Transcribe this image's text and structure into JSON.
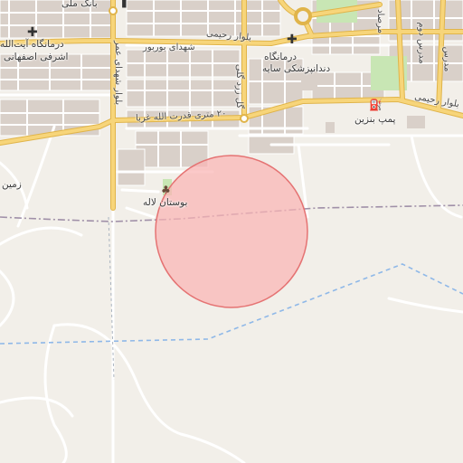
{
  "map": {
    "labels": {
      "bank": "بانک ملی",
      "clinic_left_1": "درمانگاه آیت‌الله",
      "clinic_left_2": "اشرفی اصفهانی",
      "street_martyrs": "شهدای بوربور",
      "boulevard_top": "بلوار رحیمی",
      "boulevard_right": "بلوار رحیمی",
      "clinic_right_1": "درمانگاه",
      "clinic_right_2": "دندانپزشکی سایه",
      "street_20m": "۲۰ متری قدرت الله غربا",
      "gas_station": "پمپ بنزین",
      "park": "بوستان لاله",
      "zamin": "زمین",
      "vert_road_left": "بلوار شهدای عمر",
      "vert_road_mid": "گل زرد گلی",
      "vert_road_tr1": "مرصاد",
      "vert_road_tr2": "مدرس دوم",
      "vert_road_tr3": "مدرس"
    },
    "icons": {
      "clinic_left": "plus-icon",
      "clinic_right": "plus-icon",
      "bank": "bank-icon",
      "gas": "fuel-icon",
      "park": "tree-icon"
    },
    "colors": {
      "background": "#f2efe9",
      "major_road": "#f7d57a",
      "major_road_casing": "#e0b44a",
      "minor_road": "#ffffff",
      "building": "#d9d0c9",
      "green": "#c8e6b4",
      "circle_fill": "#f9b4b4",
      "circle_stroke": "#e57373",
      "boundary": "#a090a8",
      "waterway": "#8fb8e8"
    }
  }
}
